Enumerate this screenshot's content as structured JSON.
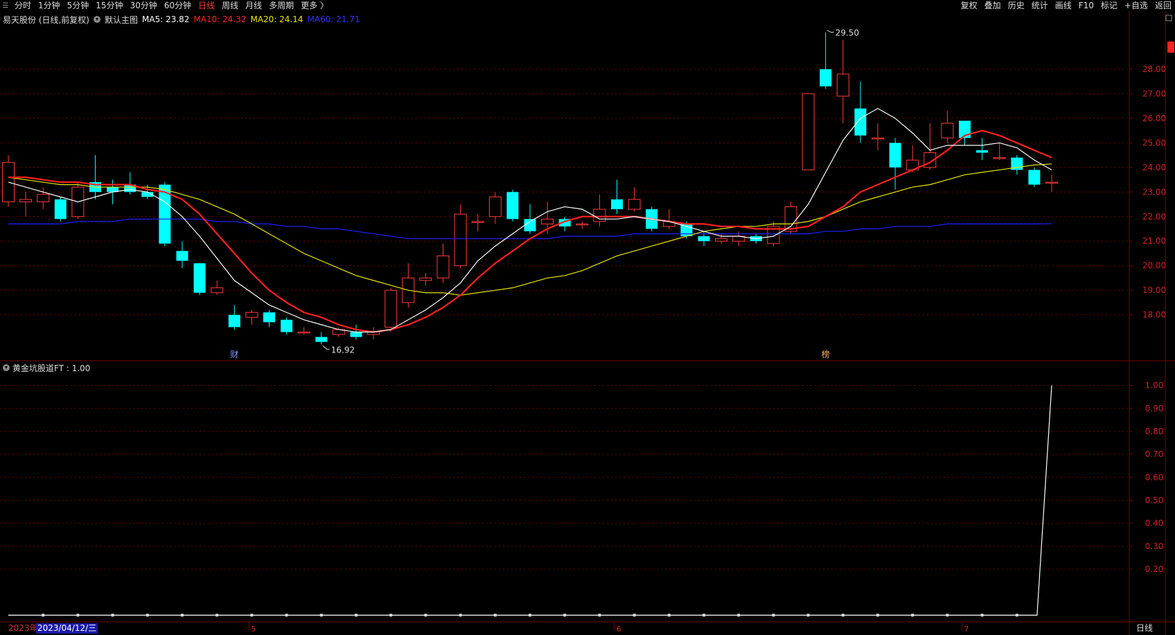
{
  "toolbar": {
    "periods": [
      "分时",
      "1分钟",
      "5分钟",
      "15分钟",
      "30分钟",
      "60分钟",
      "日线",
      "周线",
      "月线",
      "多周期",
      "更多 〉"
    ],
    "active_period": "日线",
    "right_buttons": [
      "复权",
      "叠加",
      "历史",
      "统计",
      "画线",
      "F10",
      "标记",
      "+自选",
      "返回"
    ]
  },
  "legend": {
    "stock": "易天股份 (日线,前复权)",
    "theme": "默认主图",
    "ma5": "MA5: 23.82",
    "ma10": "MA10: 24.32",
    "ma20": "MA20: 24.14",
    "ma60": "MA60: 21.71"
  },
  "colors": {
    "up": "#ff3b3b",
    "down": "#00ffff",
    "ma5": "#ffffff",
    "ma10": "#ff2020",
    "ma20": "#e8e800",
    "ma60": "#2020ff",
    "grid": "#7a0000",
    "axis_text": "#cc2222",
    "ind_line": "#ffffff"
  },
  "indicator": {
    "label": "黄金坑股道FT : 1.00",
    "yticks": [
      "1.00",
      "0.90",
      "0.80",
      "0.70",
      "0.60",
      "0.50",
      "0.40",
      "0.30",
      "0.20"
    ]
  },
  "axis": {
    "date_label": "2023/04/12/三",
    "year_label": "2023年",
    "month_ticks": [
      "5",
      "6",
      "7"
    ],
    "daily_button": "日线"
  },
  "markers": {
    "high_label": "29.50",
    "low_label": "16.92",
    "event1": "财",
    "event2": "榜"
  },
  "chart_data": {
    "type": "candlestick",
    "price_yticks": [
      "28.00",
      "27.00",
      "26.00",
      "25.00",
      "24.00",
      "23.00",
      "22.00",
      "21.00",
      "20.00",
      "19.00",
      "18.00"
    ],
    "ylim": [
      16.3,
      29.8
    ],
    "candles": [
      [
        22.6,
        24.2,
        24.5,
        22.4
      ],
      [
        22.6,
        22.7,
        23.0,
        22.0
      ],
      [
        22.6,
        22.9,
        23.2,
        22.3
      ],
      [
        22.7,
        21.9,
        22.8,
        21.8
      ],
      [
        22.0,
        23.2,
        23.4,
        21.9
      ],
      [
        23.4,
        23.0,
        24.5,
        22.7
      ],
      [
        23.2,
        23.0,
        23.5,
        22.5
      ],
      [
        23.3,
        23.0,
        23.8,
        22.9
      ],
      [
        23.0,
        22.8,
        23.3,
        22.7
      ],
      [
        23.3,
        20.9,
        23.4,
        20.8
      ],
      [
        20.6,
        20.2,
        21.0,
        19.9
      ],
      [
        20.1,
        18.9,
        20.1,
        18.8
      ],
      [
        18.9,
        19.1,
        19.4,
        18.8
      ],
      [
        18.0,
        17.5,
        18.4,
        17.4
      ],
      [
        17.9,
        18.1,
        18.2,
        17.6
      ],
      [
        18.1,
        17.7,
        18.2,
        17.5
      ],
      [
        17.8,
        17.3,
        17.9,
        17.2
      ],
      [
        17.3,
        17.3,
        17.5,
        17.2
      ],
      [
        17.1,
        16.9,
        17.3,
        16.8
      ],
      [
        17.2,
        17.4,
        17.5,
        17.1
      ],
      [
        17.3,
        17.1,
        17.6,
        17.0
      ],
      [
        17.2,
        17.3,
        17.5,
        17.0
      ],
      [
        17.5,
        19.0,
        19.1,
        17.3
      ],
      [
        18.5,
        19.5,
        20.1,
        18.3
      ],
      [
        19.4,
        19.5,
        19.7,
        19.2
      ],
      [
        19.5,
        20.4,
        20.9,
        19.3
      ],
      [
        20.0,
        22.1,
        22.5,
        19.9
      ],
      [
        21.8,
        21.8,
        22.1,
        21.4
      ],
      [
        22.0,
        22.8,
        23.0,
        21.7
      ],
      [
        23.0,
        21.9,
        23.1,
        21.8
      ],
      [
        21.9,
        21.4,
        22.5,
        21.3
      ],
      [
        21.7,
        21.9,
        22.6,
        21.3
      ],
      [
        21.9,
        21.6,
        22.0,
        21.4
      ],
      [
        21.7,
        21.7,
        21.8,
        21.5
      ],
      [
        21.8,
        22.3,
        22.9,
        21.6
      ],
      [
        22.7,
        22.3,
        23.5,
        22.1
      ],
      [
        22.3,
        22.7,
        23.2,
        22.2
      ],
      [
        22.3,
        21.5,
        22.4,
        21.4
      ],
      [
        21.6,
        21.8,
        22.3,
        21.5
      ],
      [
        21.7,
        21.2,
        21.8,
        21.1
      ],
      [
        21.2,
        21.0,
        21.4,
        20.8
      ],
      [
        21.0,
        21.1,
        21.3,
        20.9
      ],
      [
        21.0,
        21.2,
        21.4,
        20.8
      ],
      [
        21.2,
        21.0,
        21.3,
        20.9
      ],
      [
        20.9,
        21.6,
        21.8,
        20.8
      ],
      [
        21.4,
        22.4,
        22.6,
        21.3
      ],
      [
        23.9,
        27.0,
        27.0,
        23.9
      ],
      [
        28.0,
        27.3,
        29.5,
        27.2
      ],
      [
        26.9,
        27.8,
        29.2,
        25.8
      ],
      [
        26.4,
        25.3,
        27.5,
        25.0
      ],
      [
        25.2,
        25.2,
        25.8,
        24.7
      ],
      [
        25.0,
        24.0,
        25.2,
        23.1
      ],
      [
        23.9,
        24.3,
        24.9,
        23.8
      ],
      [
        24.0,
        24.6,
        25.8,
        23.9
      ],
      [
        25.2,
        25.8,
        26.3,
        25.0
      ],
      [
        25.9,
        25.2,
        25.9,
        24.9
      ],
      [
        24.7,
        24.6,
        25.2,
        24.3
      ],
      [
        24.4,
        24.4,
        25.0,
        24.3
      ],
      [
        24.4,
        23.9,
        24.5,
        23.7
      ],
      [
        23.9,
        23.3,
        24.0,
        23.2
      ],
      [
        23.4,
        23.4,
        23.7,
        23.0
      ]
    ],
    "ma5": [
      23.4,
      23.2,
      23.0,
      22.8,
      22.6,
      22.8,
      23.0,
      23.1,
      23.0,
      22.6,
      22.0,
      21.2,
      20.3,
      19.4,
      18.9,
      18.4,
      18.1,
      17.8,
      17.6,
      17.4,
      17.3,
      17.3,
      17.4,
      17.8,
      18.2,
      18.7,
      19.3,
      20.2,
      20.8,
      21.3,
      21.8,
      22.2,
      22.4,
      22.3,
      21.9,
      21.9,
      22.0,
      21.9,
      21.8,
      21.6,
      21.4,
      21.2,
      21.2,
      21.1,
      21.2,
      21.6,
      22.5,
      23.8,
      25.1,
      26.0,
      26.4,
      26.0,
      25.4,
      24.7,
      24.9,
      24.9,
      24.9,
      25.0,
      24.8,
      24.3,
      23.9
    ],
    "ma10": [
      23.6,
      23.6,
      23.5,
      23.4,
      23.4,
      23.3,
      23.3,
      23.3,
      23.1,
      23.0,
      22.7,
      22.1,
      21.3,
      20.5,
      19.7,
      19.0,
      18.5,
      18.1,
      17.9,
      17.6,
      17.4,
      17.3,
      17.4,
      17.6,
      17.9,
      18.3,
      18.8,
      19.5,
      20.1,
      20.6,
      21.1,
      21.5,
      21.8,
      22.0,
      22.0,
      22.0,
      22.0,
      21.9,
      21.8,
      21.7,
      21.7,
      21.6,
      21.6,
      21.5,
      21.5,
      21.5,
      21.6,
      22.0,
      22.4,
      23.0,
      23.3,
      23.6,
      23.9,
      24.2,
      24.7,
      25.3,
      25.5,
      25.3,
      25.0,
      24.7,
      24.4
    ],
    "ma20": [
      23.6,
      23.5,
      23.4,
      23.3,
      23.3,
      23.2,
      23.2,
      23.2,
      23.2,
      23.1,
      22.9,
      22.7,
      22.4,
      22.1,
      21.7,
      21.3,
      20.9,
      20.5,
      20.2,
      19.9,
      19.6,
      19.4,
      19.2,
      19.0,
      18.9,
      18.9,
      18.8,
      18.9,
      19.0,
      19.1,
      19.3,
      19.5,
      19.6,
      19.8,
      20.1,
      20.4,
      20.6,
      20.8,
      21.0,
      21.2,
      21.4,
      21.5,
      21.6,
      21.6,
      21.7,
      21.7,
      21.8,
      22.0,
      22.3,
      22.6,
      22.8,
      23.0,
      23.2,
      23.3,
      23.5,
      23.7,
      23.8,
      23.9,
      24.0,
      24.1,
      24.14
    ],
    "ma60": [
      21.7,
      21.7,
      21.7,
      21.7,
      21.8,
      21.8,
      21.8,
      21.9,
      21.9,
      21.9,
      21.9,
      21.9,
      21.8,
      21.8,
      21.7,
      21.7,
      21.6,
      21.6,
      21.5,
      21.5,
      21.4,
      21.3,
      21.2,
      21.1,
      21.1,
      21.1,
      21.1,
      21.1,
      21.1,
      21.1,
      21.1,
      21.1,
      21.2,
      21.2,
      21.2,
      21.2,
      21.3,
      21.3,
      21.3,
      21.3,
      21.3,
      21.3,
      21.3,
      21.3,
      21.3,
      21.3,
      21.3,
      21.4,
      21.4,
      21.5,
      21.5,
      21.6,
      21.6,
      21.6,
      21.7,
      21.7,
      21.7,
      21.7,
      21.7,
      21.7,
      21.71
    ],
    "indicator_values": [
      0,
      0,
      0,
      0,
      0,
      0,
      0,
      0,
      0,
      0,
      0,
      0,
      0,
      0,
      0,
      0,
      0,
      0,
      0,
      0,
      0,
      0,
      0,
      0,
      0,
      0,
      0,
      0,
      0,
      0,
      0,
      0,
      0,
      0,
      0,
      0,
      0,
      0,
      0,
      0,
      0,
      0,
      0,
      0,
      0,
      0,
      0,
      0,
      0,
      0,
      0,
      0,
      0,
      0,
      0,
      0,
      0,
      0,
      0,
      0,
      1.0
    ],
    "indicator_ylim": [
      -0.02,
      1.05
    ]
  }
}
